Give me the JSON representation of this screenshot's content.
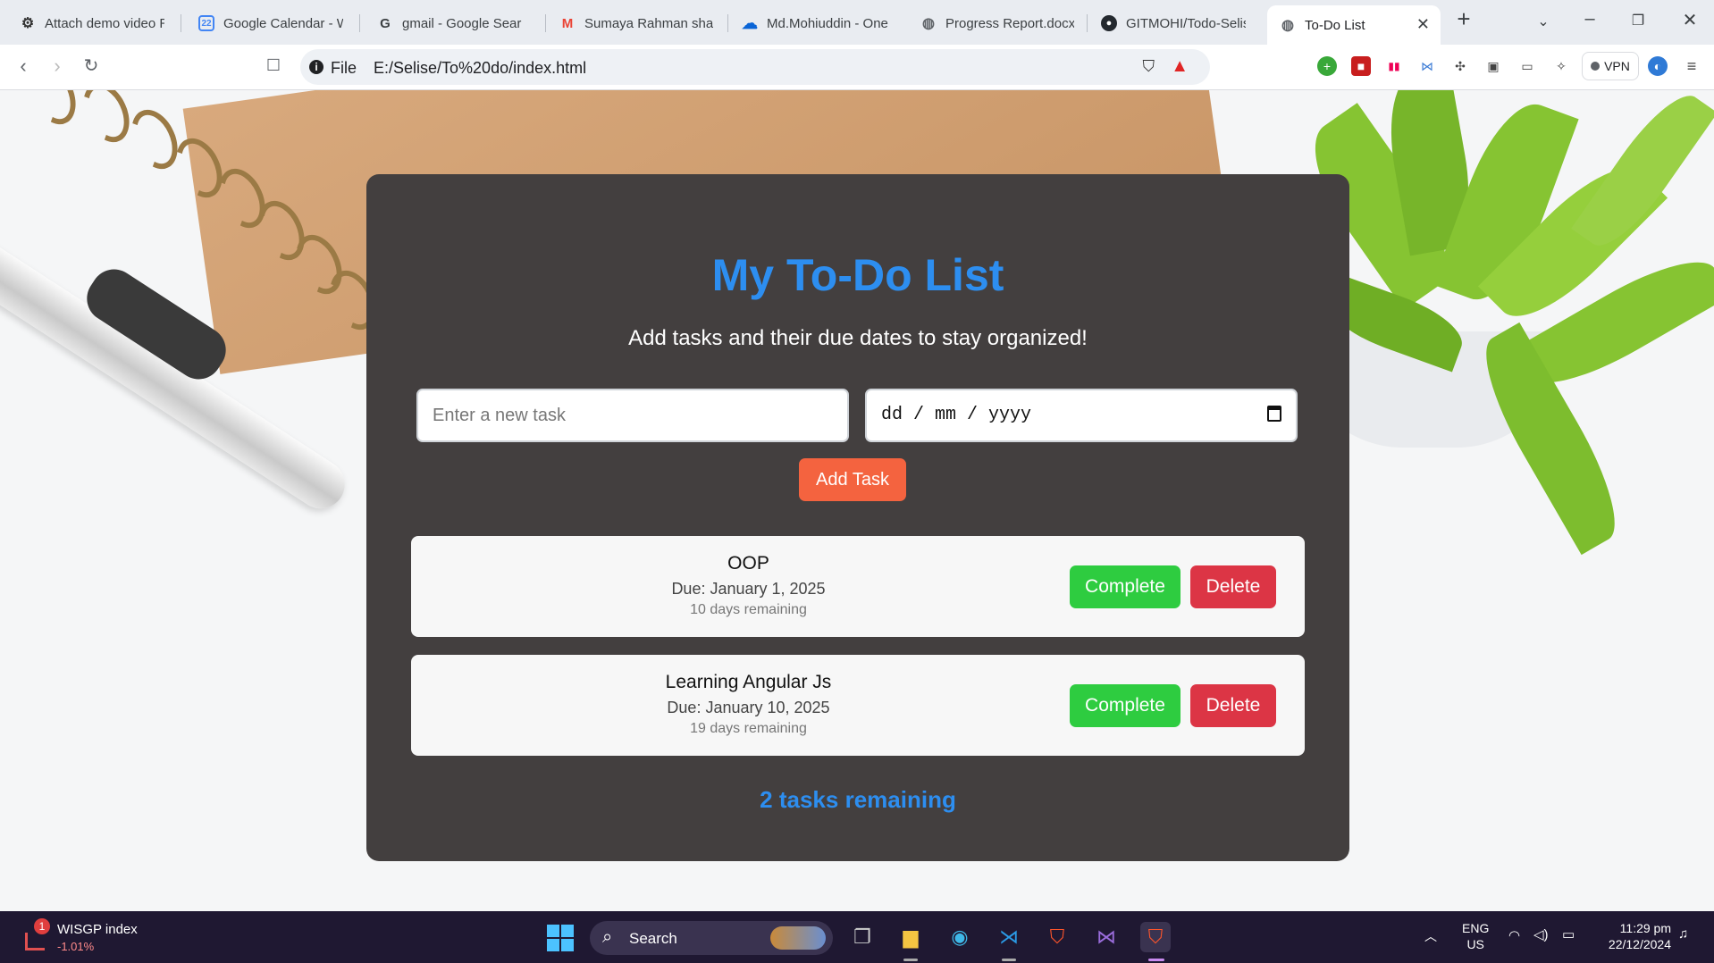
{
  "browser": {
    "tabs": [
      {
        "label": "Attach demo video R",
        "icon": "openai-icon"
      },
      {
        "label": "Google Calendar - W",
        "icon": "calendar-icon"
      },
      {
        "label": "gmail - Google Searc",
        "icon": "google-icon"
      },
      {
        "label": "Sumaya Rahman sha",
        "icon": "gmail-icon"
      },
      {
        "label": "Md.Mohiuddin - One",
        "icon": "onedrive-icon"
      },
      {
        "label": "Progress Report.docx",
        "icon": "globe-icon"
      },
      {
        "label": "GITMOHI/Todo-Selis",
        "icon": "github-icon"
      },
      {
        "label": "To-Do List",
        "icon": "globe-icon",
        "active": true
      }
    ],
    "calendar_badge": "22",
    "scheme_label": "File",
    "url": "E:/Selise/To%20do/index.html",
    "vpn_label": "VPN"
  },
  "app": {
    "title": "My To-Do List",
    "subtitle": "Add tasks and their due dates to stay organized!",
    "task_placeholder": "Enter a new task",
    "date_placeholder": "dd / mm / yyyy",
    "add_button": "Add Task",
    "complete_label": "Complete",
    "delete_label": "Delete",
    "tasks": [
      {
        "name": "OOP",
        "due": "Due: January 1, 2025",
        "remaining": "10 days remaining"
      },
      {
        "name": "Learning Angular Js",
        "due": "Due: January 10, 2025",
        "remaining": "19 days remaining"
      }
    ],
    "tasks_remaining": "2 tasks remaining",
    "colors": {
      "title": "#2d8ef0",
      "card": "#433f3f",
      "add_button": "#f4633f",
      "complete_button": "#2ecc40",
      "delete_button": "#dc3545"
    }
  },
  "taskbar": {
    "widget_badge": "1",
    "widget_title": "WISGP index",
    "widget_value": "-1.01%",
    "search_label": "Search",
    "language": "ENG",
    "region": "US",
    "time": "11:29 pm",
    "date": "22/12/2024"
  }
}
